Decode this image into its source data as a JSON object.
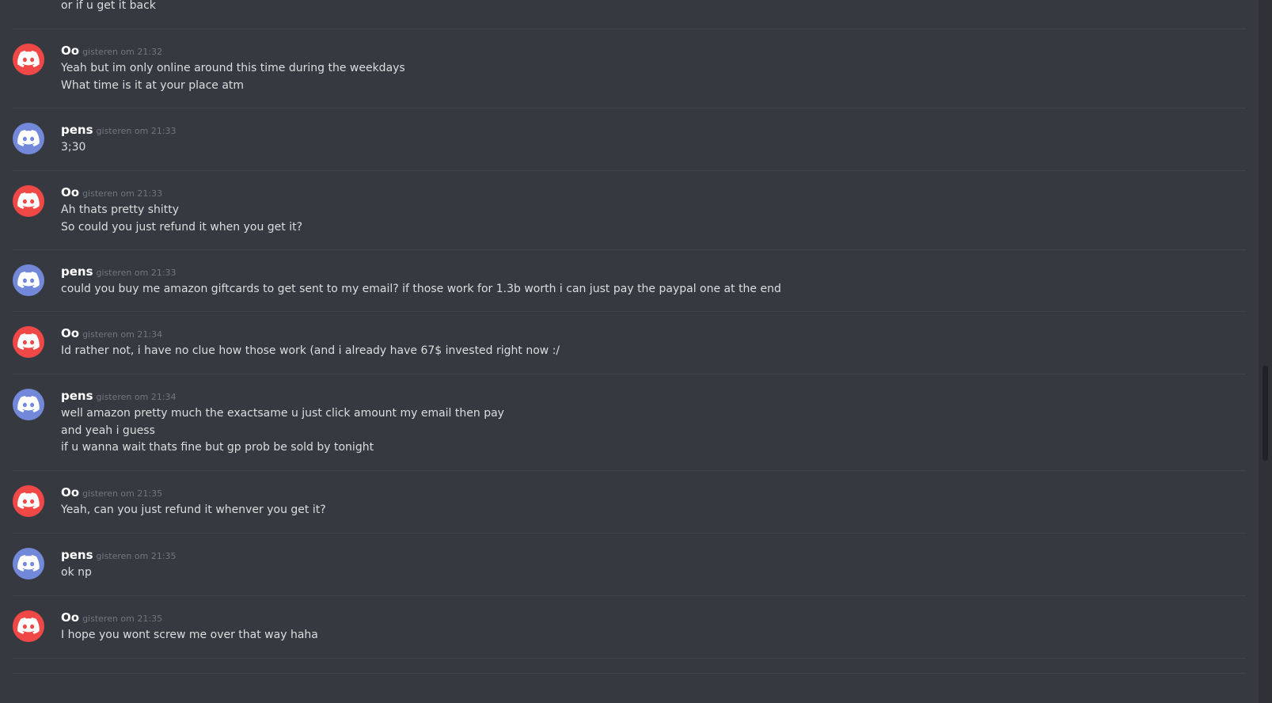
{
  "colors": {
    "background": "#36393f",
    "avatar_red": "#f04747",
    "avatar_blurple": "#7289da",
    "text": "#dcddde",
    "author": "#ffffff",
    "timestamp": "#72767d"
  },
  "top_fragment": "or if u get it back",
  "messages": [
    {
      "author": "Oo",
      "avatar_icon": "discord-logo-icon",
      "avatar_color": "red",
      "timestamp": "gisteren om 21:32",
      "lines": [
        "Yeah but im only online around this time during the weekdays",
        "What time is it at your place atm"
      ]
    },
    {
      "author": "pens",
      "avatar_icon": "discord-logo-icon",
      "avatar_color": "blurple",
      "timestamp": "gisteren om 21:33",
      "lines": [
        "3;30"
      ]
    },
    {
      "author": "Oo",
      "avatar_icon": "discord-logo-icon",
      "avatar_color": "red",
      "timestamp": "gisteren om 21:33",
      "lines": [
        "Ah thats pretty shitty",
        "So could you just refund it when you get it?"
      ]
    },
    {
      "author": "pens",
      "avatar_icon": "discord-logo-icon",
      "avatar_color": "blurple",
      "timestamp": "gisteren om 21:33",
      "lines": [
        "could you buy me amazon giftcards to get sent to my email? if those work for 1.3b worth i can just pay the paypal one at the end"
      ]
    },
    {
      "author": "Oo",
      "avatar_icon": "discord-logo-icon",
      "avatar_color": "red",
      "timestamp": "gisteren om 21:34",
      "lines": [
        "Id rather not, i have no clue how those work (and i already have 67$ invested right now :/"
      ]
    },
    {
      "author": "pens",
      "avatar_icon": "discord-logo-icon",
      "avatar_color": "blurple",
      "timestamp": "gisteren om 21:34",
      "lines": [
        "well amazon pretty much the exactsame u just click amount my email then pay",
        "and yeah i guess",
        "if u wanna wait thats fine but gp prob be sold by tonight"
      ]
    },
    {
      "author": "Oo",
      "avatar_icon": "discord-logo-icon",
      "avatar_color": "red",
      "timestamp": "gisteren om 21:35",
      "lines": [
        "Yeah, can you just refund it whenver you get it?"
      ]
    },
    {
      "author": "pens",
      "avatar_icon": "discord-logo-icon",
      "avatar_color": "blurple",
      "timestamp": "gisteren om 21:35",
      "lines": [
        "ok np"
      ]
    },
    {
      "author": "Oo",
      "avatar_icon": "discord-logo-icon",
      "avatar_color": "red",
      "timestamp": "gisteren om 21:35",
      "lines": [
        "I hope you wont screw me over that way haha"
      ]
    }
  ]
}
